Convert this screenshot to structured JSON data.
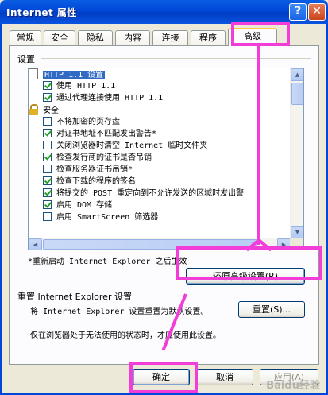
{
  "window": {
    "title": "Internet 属性",
    "help_glyph": "?",
    "close_glyph": "✕"
  },
  "tabs": [
    {
      "label": "常规"
    },
    {
      "label": "安全"
    },
    {
      "label": "隐私"
    },
    {
      "label": "内容"
    },
    {
      "label": "连接"
    },
    {
      "label": "程序"
    },
    {
      "label": "高级",
      "active": true
    }
  ],
  "settings": {
    "group_label": "设置",
    "items": [
      {
        "type": "header",
        "icon": "page-icon",
        "label": "HTTP 1.1 设置",
        "selected": true
      },
      {
        "type": "checkbox",
        "checked": true,
        "label": "使用 HTTP 1.1"
      },
      {
        "type": "checkbox",
        "checked": true,
        "label": "通过代理连接使用 HTTP 1.1"
      },
      {
        "type": "header",
        "icon": "lock-icon",
        "label": "安全"
      },
      {
        "type": "checkbox",
        "checked": false,
        "label": "不将加密的页存盘"
      },
      {
        "type": "checkbox",
        "checked": true,
        "label": "对证书地址不匹配发出警告*"
      },
      {
        "type": "checkbox",
        "checked": false,
        "label": "关闭浏览器时清空 Internet 临时文件夹"
      },
      {
        "type": "checkbox",
        "checked": true,
        "label": "检查发行商的证书是否吊销"
      },
      {
        "type": "checkbox",
        "checked": false,
        "label": "检查服务器证书吊销*"
      },
      {
        "type": "checkbox",
        "checked": true,
        "label": "检查下载的程序的签名"
      },
      {
        "type": "checkbox",
        "checked": true,
        "label": "将提交的 POST 重定向到不允许发送的区域时发出警"
      },
      {
        "type": "checkbox",
        "checked": true,
        "label": "启用 DOM 存储"
      },
      {
        "type": "checkbox",
        "checked": false,
        "label": "启用 SmartScreen 筛选器"
      }
    ],
    "restart_note": "*重新启动 Internet Explorer 之后生效",
    "restore_button": "还原高级设置(R)"
  },
  "reset": {
    "group_label": "重置 Internet Explorer 设置",
    "description": "将 Internet Explorer 设置重置为默认设置。",
    "button": "重置(S)...",
    "note": "仅在浏览器处于无法使用的状态时，才应使用此设置。"
  },
  "footer": {
    "ok": "确定",
    "cancel": "取消",
    "apply": "应用(A)"
  },
  "watermark": "Baidu经验",
  "colors": {
    "annotation": "#f23dd9",
    "titlebar": "#0047d6",
    "selection": "#316ac5"
  }
}
